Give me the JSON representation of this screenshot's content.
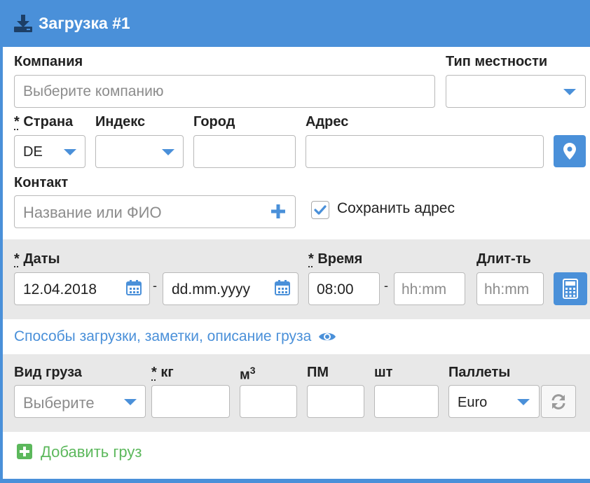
{
  "header": {
    "title": "Загрузка #1",
    "icon": "download-icon"
  },
  "colors": {
    "accent": "#4a90d9",
    "band": "#e8e8e8",
    "green": "#5cb85c"
  },
  "company": {
    "label": "Компания",
    "placeholder": "Выберите компанию"
  },
  "terrain": {
    "label": "Тип местности",
    "value": ""
  },
  "country": {
    "required_mark": "*",
    "label": "Страна",
    "value": "DE"
  },
  "postal": {
    "label": "Индекс",
    "value": ""
  },
  "city": {
    "label": "Город",
    "value": ""
  },
  "address": {
    "label": "Адрес",
    "value": "",
    "locate_icon": "map-marker-icon"
  },
  "contact": {
    "label": "Контакт",
    "placeholder": "Название или ФИО",
    "add_icon": "plus-icon"
  },
  "save_address": {
    "label": "Сохранить адрес",
    "checked": true
  },
  "dates": {
    "required_mark": "*",
    "label": "Даты",
    "from": "12.04.2018",
    "to_placeholder": "dd.mm.yyyy",
    "separator": "-"
  },
  "time": {
    "required_mark": "*",
    "label": "Время",
    "from": "08:00",
    "to_placeholder": "hh:mm",
    "separator": "-"
  },
  "duration": {
    "label": "Длит-ть",
    "placeholder": "hh:mm",
    "calc_icon": "calculator-icon"
  },
  "options_link": {
    "label": "Способы загрузки, заметки, описание груза",
    "icon": "eye-icon"
  },
  "cargo": {
    "type_label": "Вид груза",
    "type_placeholder": "Выберите",
    "kg_required_mark": "*",
    "kg_label": "кг",
    "m3_label": "м",
    "m3_sup": "3",
    "pm_label": "ПМ",
    "pcs_label": "шт",
    "pallets_label": "Паллеты",
    "pallets_value": "Euro",
    "refresh_icon": "refresh-icon"
  },
  "add_cargo": {
    "label": "Добавить груз",
    "icon": "plus-square-icon"
  }
}
